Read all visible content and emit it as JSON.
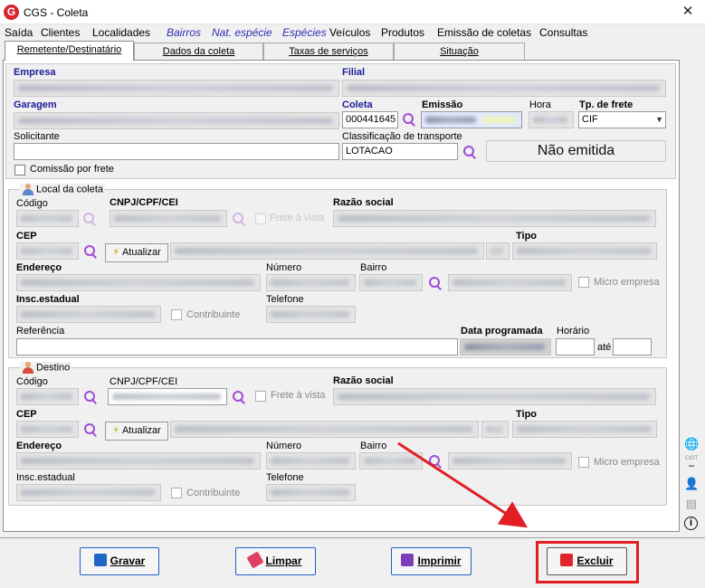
{
  "window": {
    "title": "CGS - Coleta",
    "close_glyph": "✕",
    "logo_letter": "G"
  },
  "menu": [
    {
      "label": "Saída",
      "emphasis": false
    },
    {
      "label": "Clientes",
      "emphasis": false
    },
    {
      "label": "Localidades",
      "emphasis": false
    },
    {
      "label": "Bairros",
      "emphasis": true
    },
    {
      "label": "Nat. espécie",
      "emphasis": true
    },
    {
      "label": "Espécies",
      "emphasis": true
    },
    {
      "label": "Veículos",
      "emphasis": false
    },
    {
      "label": "Produtos",
      "emphasis": false
    },
    {
      "label": "Emissão de coletas",
      "emphasis": false
    },
    {
      "label": "Consultas",
      "emphasis": false
    }
  ],
  "tabs": [
    {
      "label": "Remetente/Destinatário",
      "active": true
    },
    {
      "label": "Dados da coleta",
      "active": false
    },
    {
      "label": "Taxas de serviços",
      "active": false
    },
    {
      "label": "Situação",
      "active": false
    }
  ],
  "header": {
    "empresa_label": "Empresa",
    "filial_label": "Filial",
    "garagem_label": "Garagem",
    "coleta_label": "Coleta",
    "coleta_value": "000441645",
    "emissao_label": "Emissão",
    "hora_label": "Hora",
    "tp_frete_label": "Tp. de frete",
    "tp_frete_value": "CIF",
    "solicitante_label": "Solicitante",
    "solicitante_value": "",
    "classificacao_label": "Classificação de transporte",
    "classificacao_value": "LOTACAO",
    "status_text": "Não emitida",
    "comissao_label": "Comissão por frete"
  },
  "local_coleta": {
    "legend": "Local da coleta",
    "codigo_label": "Código",
    "cnpj_label": "CNPJ/CPF/CEI",
    "frete_vista_label": "Frete à vista",
    "razao_label": "Razão social",
    "cep_label": "CEP",
    "atualizar_label": "Atualizar",
    "tipo_label": "Tipo",
    "endereco_label": "Endereço",
    "numero_label": "Número",
    "bairro_label": "Bairro",
    "micro_label": "Micro empresa",
    "insc_label": "Insc.estadual",
    "contribuinte_label": "Contribuinte",
    "telefone_label": "Telefone",
    "referencia_label": "Referência",
    "referencia_value": "",
    "data_prog_label": "Data programada",
    "horario_label": "Horário",
    "ate_label": "até"
  },
  "destino": {
    "legend": "Destino",
    "codigo_label": "Código",
    "cnpj_label": "CNPJ/CPF/CEI",
    "frete_vista_label": "Frete à vista",
    "razao_label": "Razão social",
    "cep_label": "CEP",
    "atualizar_label": "Atualizar",
    "tipo_label": "Tipo",
    "endereco_label": "Endereço",
    "numero_label": "Número",
    "bairro_label": "Bairro",
    "micro_label": "Micro empresa",
    "insc_label": "Insc.estadual",
    "contribuinte_label": "Contribuinte",
    "telefone_label": "Telefone"
  },
  "side_icons": [
    "globe-icon",
    "ciot-icon",
    "driver-icon",
    "document-icon",
    "info-icon"
  ],
  "side_icon_labels": {
    "ciot": "CIOT",
    "info": "i"
  },
  "buttons": {
    "gravar": "Gravar",
    "limpar": "Limpar",
    "imprimir": "Imprimir",
    "excluir": "Excluir"
  },
  "colors": {
    "annotation_red": "#e21e24",
    "button_border": "#1e5fc9",
    "menu_emphasis": "#2f2fb4",
    "label_blue": "#1b1b99"
  }
}
